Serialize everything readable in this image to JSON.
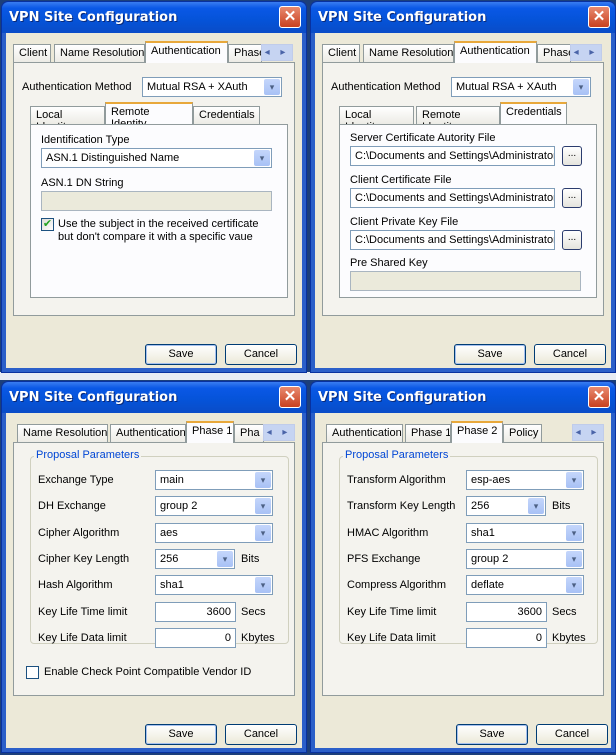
{
  "windows": [
    {
      "title": "VPN Site Configuration",
      "close_glyph": "✕",
      "tabs": [
        "Client",
        "Name Resolution",
        "Authentication",
        "Phase"
      ],
      "active_tab": "Authentication",
      "tab_scroll": "◂ ▸",
      "auth_method_label": "Authentication Method",
      "auth_method_value": "Mutual RSA + XAuth",
      "subtabs": [
        "Local Identity",
        "Remote Identity",
        "Credentials"
      ],
      "active_subtab": "Remote Identity",
      "id_type_label": "Identification Type",
      "id_type_value": "ASN.1 Distinguished Name",
      "dn_string_label": "ASN.1 DN String",
      "dn_string_value": "",
      "use_subject_checked": true,
      "use_subject_label_1": "Use the subject in the received certificate",
      "use_subject_label_2": "but don't compare it with a specific vaue",
      "save_label": "Save",
      "cancel_label": "Cancel"
    },
    {
      "title": "VPN Site Configuration",
      "close_glyph": "✕",
      "tabs": [
        "Client",
        "Name Resolution",
        "Authentication",
        "Phase"
      ],
      "active_tab": "Authentication",
      "tab_scroll": "◂ ▸",
      "auth_method_label": "Authentication Method",
      "auth_method_value": "Mutual RSA + XAuth",
      "subtabs": [
        "Local Identity",
        "Remote Identity",
        "Credentials"
      ],
      "active_subtab": "Credentials",
      "server_ca_label": "Server Certificate Autority File",
      "server_ca_value": "C:\\Documents and Settings\\Administrator",
      "client_cert_label": "Client Certificate File",
      "client_cert_value": "C:\\Documents and Settings\\Administrator",
      "client_key_label": "Client Private Key File",
      "client_key_value": "C:\\Documents and Settings\\Administrator",
      "psk_label": "Pre Shared Key",
      "psk_value": "",
      "browse_label": "...",
      "save_label": "Save",
      "cancel_label": "Cancel"
    },
    {
      "title": "VPN Site Configuration",
      "close_glyph": "✕",
      "tabs": [
        "Name Resolution",
        "Authentication",
        "Phase 1",
        "Pha"
      ],
      "active_tab": "Phase 1",
      "tab_scroll": "◂ ▸",
      "group_label": "Proposal Parameters",
      "fields": [
        {
          "label": "Exchange Type",
          "value": "main",
          "type": "combo"
        },
        {
          "label": "DH Exchange",
          "value": "group 2",
          "type": "combo"
        },
        {
          "label": "Cipher Algorithm",
          "value": "aes",
          "type": "combo"
        },
        {
          "label": "Cipher Key Length",
          "value": "256",
          "type": "combo-short",
          "unit": "Bits"
        },
        {
          "label": "Hash Algorithm",
          "value": "sha1",
          "type": "combo"
        },
        {
          "label": "Key Life Time limit",
          "value": "3600",
          "type": "number",
          "unit": "Secs"
        },
        {
          "label": "Key Life Data limit",
          "value": "0",
          "type": "number",
          "unit": "Kbytes"
        }
      ],
      "vendor_id_checked": false,
      "vendor_id_label": "Enable Check Point Compatible Vendor ID",
      "save_label": "Save",
      "cancel_label": "Cancel"
    },
    {
      "title": "VPN Site Configuration",
      "close_glyph": "✕",
      "tabs": [
        "Authentication",
        "Phase 1",
        "Phase 2",
        "Policy"
      ],
      "active_tab": "Phase 2",
      "tab_scroll": "◂ ▸",
      "group_label": "Proposal Parameters",
      "fields": [
        {
          "label": "Transform Algorithm",
          "value": "esp-aes",
          "type": "combo"
        },
        {
          "label": "Transform Key Length",
          "value": "256",
          "type": "combo-short",
          "unit": "Bits"
        },
        {
          "label": "HMAC Algorithm",
          "value": "sha1",
          "type": "combo"
        },
        {
          "label": "PFS Exchange",
          "value": "group 2",
          "type": "combo"
        },
        {
          "label": "Compress Algorithm",
          "value": "deflate",
          "type": "combo"
        },
        {
          "label": "Key Life Time limit",
          "value": "3600",
          "type": "number",
          "unit": "Secs"
        },
        {
          "label": "Key Life Data limit",
          "value": "0",
          "type": "number",
          "unit": "Kbytes"
        }
      ],
      "save_label": "Save",
      "cancel_label": "Cancel"
    }
  ],
  "icons": {
    "dropdown": "▾",
    "check": "✔"
  }
}
